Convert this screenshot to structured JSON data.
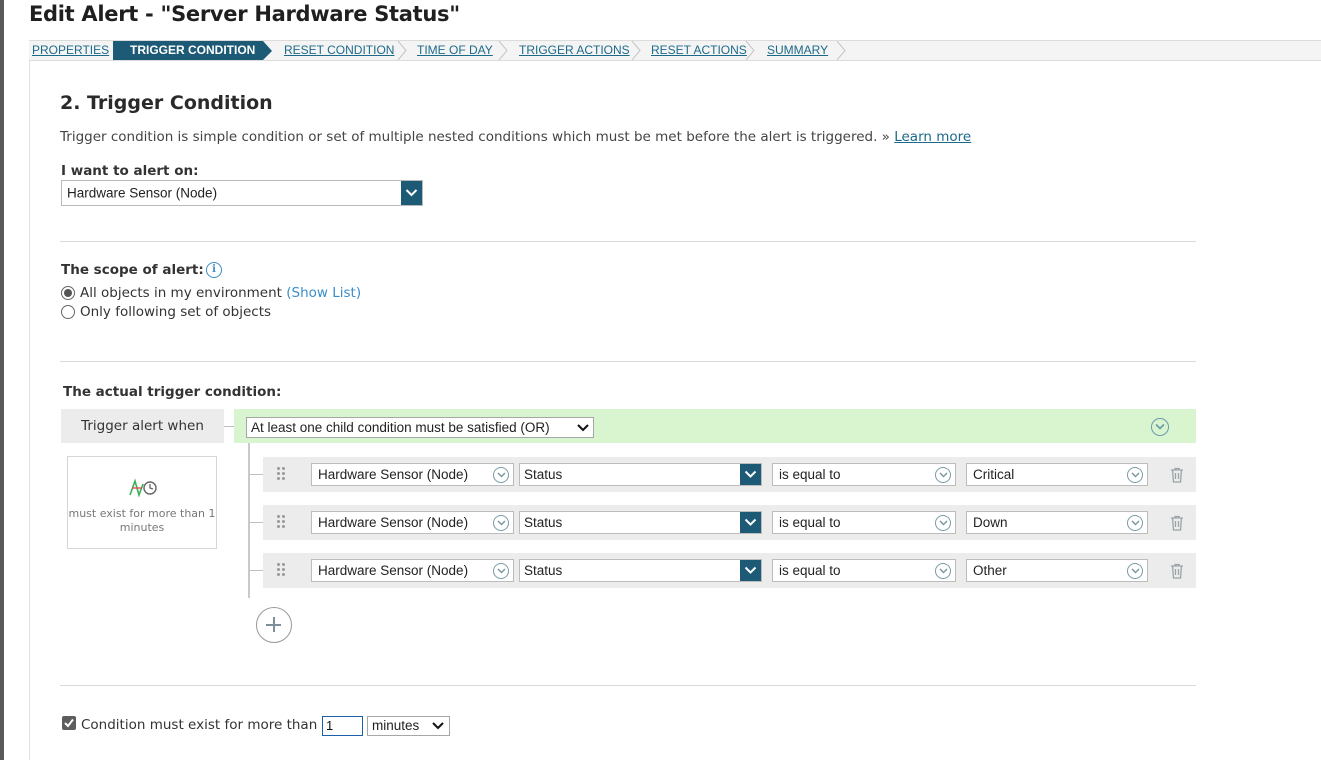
{
  "page": {
    "title": "Edit Alert - \"Server Hardware Status\""
  },
  "wizard": {
    "steps": [
      {
        "label": "PROPERTIES",
        "active": false
      },
      {
        "label": "TRIGGER CONDITION",
        "active": true
      },
      {
        "label": "RESET CONDITION",
        "active": false
      },
      {
        "label": "TIME OF DAY",
        "active": false
      },
      {
        "label": "TRIGGER ACTIONS",
        "active": false
      },
      {
        "label": "RESET ACTIONS",
        "active": false
      },
      {
        "label": "SUMMARY",
        "active": false
      }
    ]
  },
  "section": {
    "heading": "2. Trigger Condition",
    "description": "Trigger condition is simple condition or set of multiple nested conditions which must be met before the alert is triggered. »",
    "learn_more": "Learn more"
  },
  "alert_on": {
    "label": "I want to alert on:",
    "value": "Hardware Sensor (Node)"
  },
  "scope": {
    "label": "The scope of alert:",
    "options": [
      {
        "label": "All objects in my environment",
        "link": "(Show List)",
        "selected": true
      },
      {
        "label": "Only following set of objects",
        "selected": false
      }
    ]
  },
  "trigger": {
    "label": "The actual trigger condition:",
    "when_label": "Trigger alert when",
    "group_operator": "At least one child condition must be satisfied (OR)",
    "timer_caption": "must exist for more than 1 minutes",
    "conditions": [
      {
        "object": "Hardware Sensor (Node)",
        "field": "Status",
        "operator": "is equal to",
        "value": "Critical"
      },
      {
        "object": "Hardware Sensor (Node)",
        "field": "Status",
        "operator": "is equal to",
        "value": "Down"
      },
      {
        "object": "Hardware Sensor (Node)",
        "field": "Status",
        "operator": "is equal to",
        "value": "Other"
      }
    ]
  },
  "duration": {
    "checked": true,
    "label": "Condition must exist for more than",
    "value": "1",
    "unit": "minutes"
  },
  "colors": {
    "accent": "#1c5a75",
    "link": "#1c6a8a",
    "or_bar": "#d9f5cf"
  }
}
